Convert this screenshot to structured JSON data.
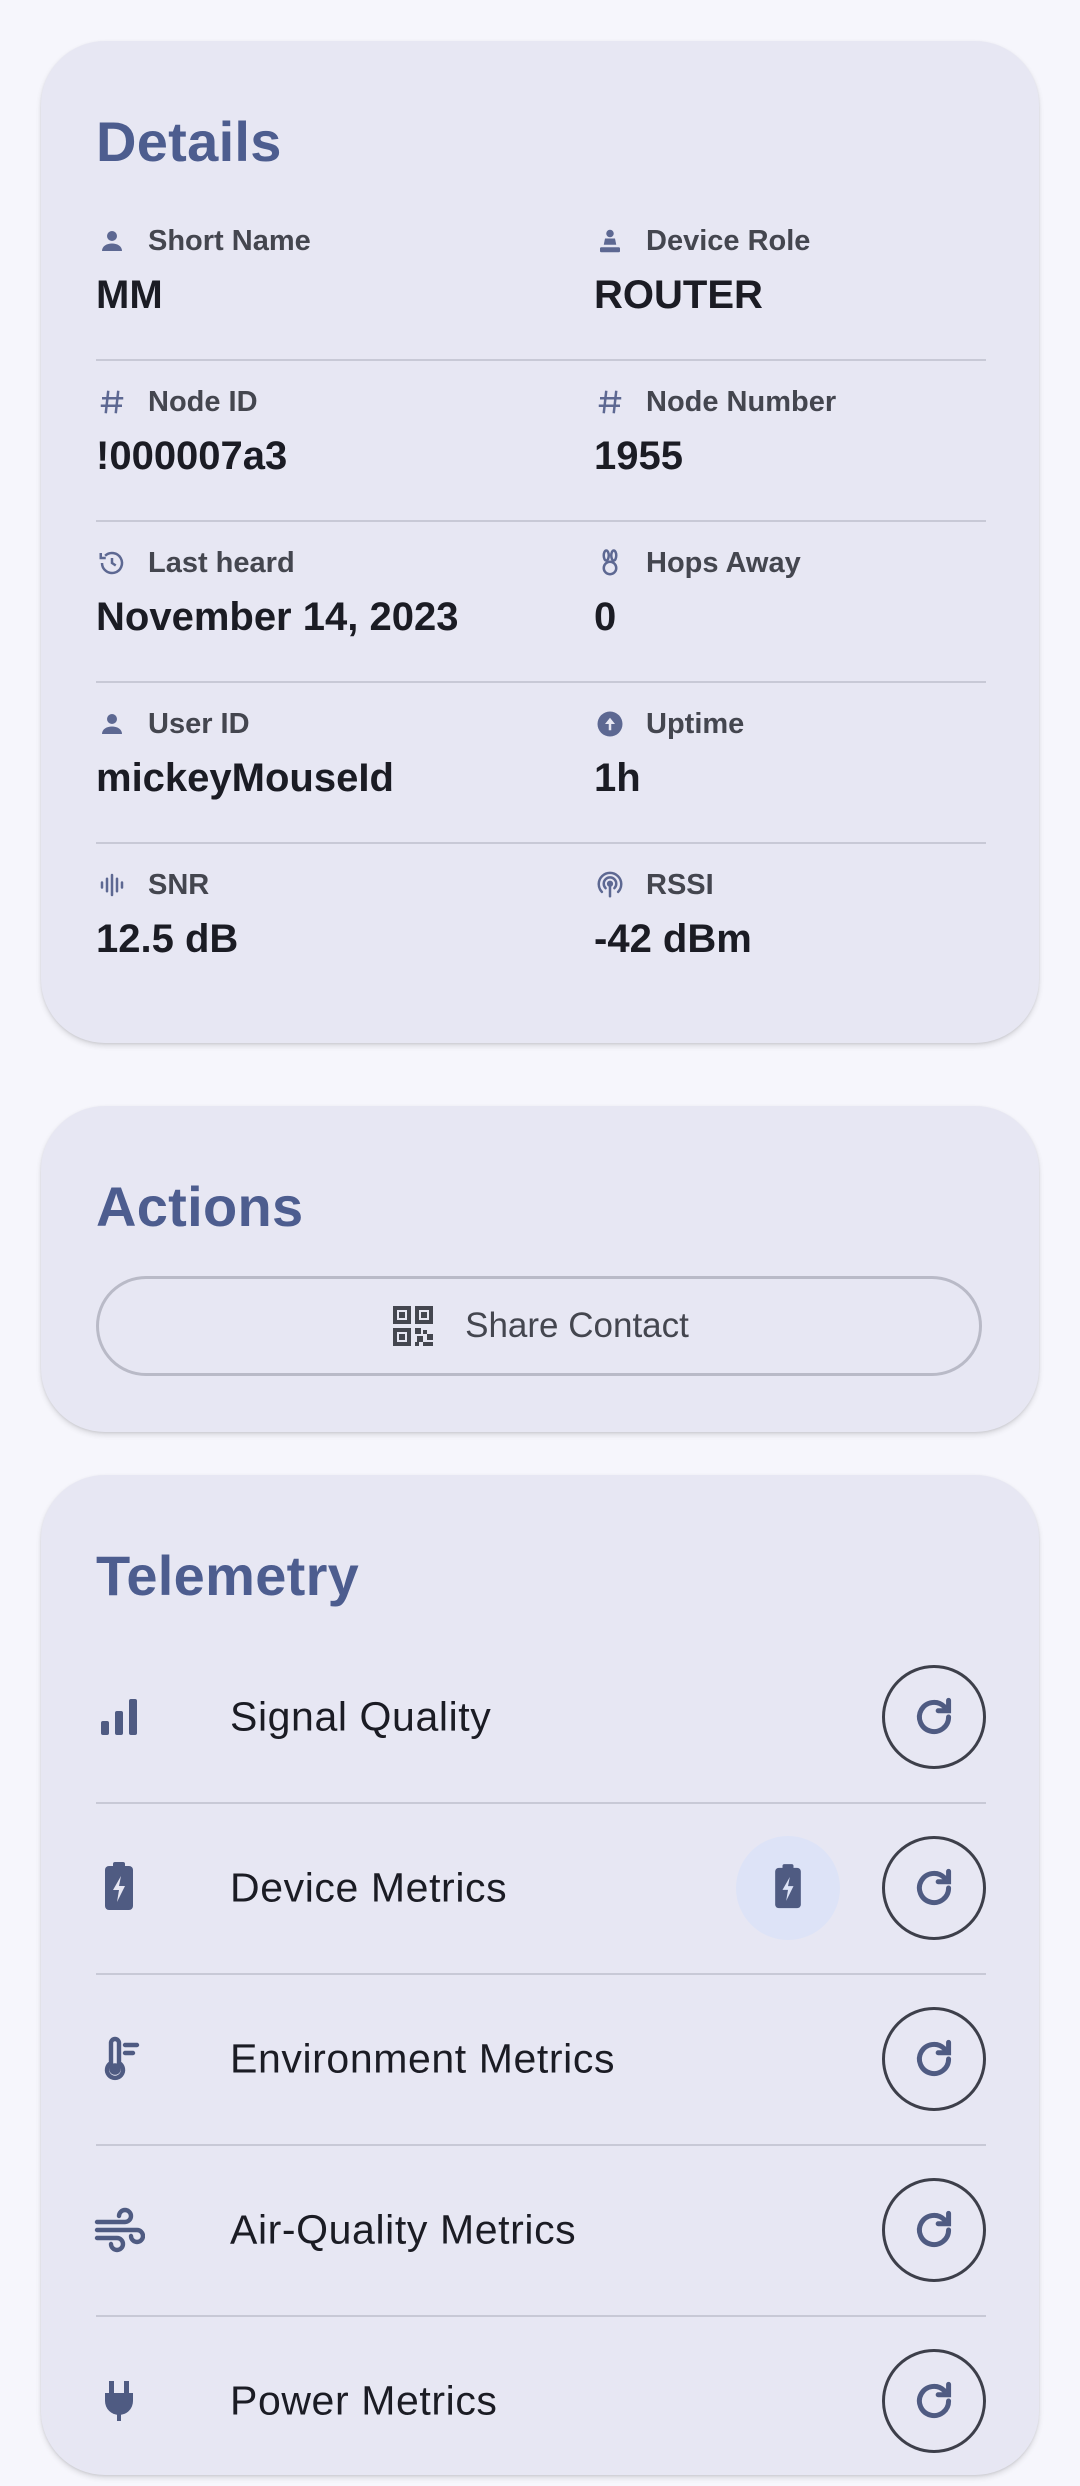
{
  "details": {
    "title": "Details",
    "rows": [
      {
        "left": {
          "icon": "person-icon",
          "label": "Short Name",
          "value": "MM"
        },
        "right": {
          "icon": "device-role-icon",
          "label": "Device Role",
          "value": "ROUTER"
        }
      },
      {
        "left": {
          "icon": "hash-icon",
          "label": "Node ID",
          "value": "!000007a3"
        },
        "right": {
          "icon": "hash-icon",
          "label": "Node Number",
          "value": "1955"
        }
      },
      {
        "left": {
          "icon": "history-icon",
          "label": "Last heard",
          "value": "November 14, 2023"
        },
        "right": {
          "icon": "hops-rabbit-icon",
          "label": "Hops Away",
          "value": "0"
        }
      },
      {
        "left": {
          "icon": "person-icon",
          "label": "User ID",
          "value": "mickeyMouseId"
        },
        "right": {
          "icon": "upload-circle-icon",
          "label": "Uptime",
          "value": "1h"
        }
      },
      {
        "left": {
          "icon": "waveform-icon",
          "label": "SNR",
          "value": "12.5 dB"
        },
        "right": {
          "icon": "antenna-icon",
          "label": "RSSI",
          "value": "-42 dBm"
        }
      }
    ]
  },
  "actions": {
    "title": "Actions",
    "share_contact": {
      "icon": "qr-code-icon",
      "label": "Share Contact"
    }
  },
  "telemetry": {
    "title": "Telemetry",
    "items": [
      {
        "icon": "signal-bars-icon",
        "label": "Signal Quality"
      },
      {
        "icon": "battery-charging-icon",
        "label": "Device Metrics"
      },
      {
        "icon": "thermometer-icon",
        "label": "Environment Metrics"
      },
      {
        "icon": "wind-icon",
        "label": "Air-Quality Metrics"
      },
      {
        "icon": "power-plug-icon",
        "label": "Power Metrics"
      }
    ]
  },
  "colors": {
    "accent": "#4d5d8f",
    "card": "#e7e7f3",
    "background": "#f6f6fc",
    "icon": "#4f5b82"
  }
}
